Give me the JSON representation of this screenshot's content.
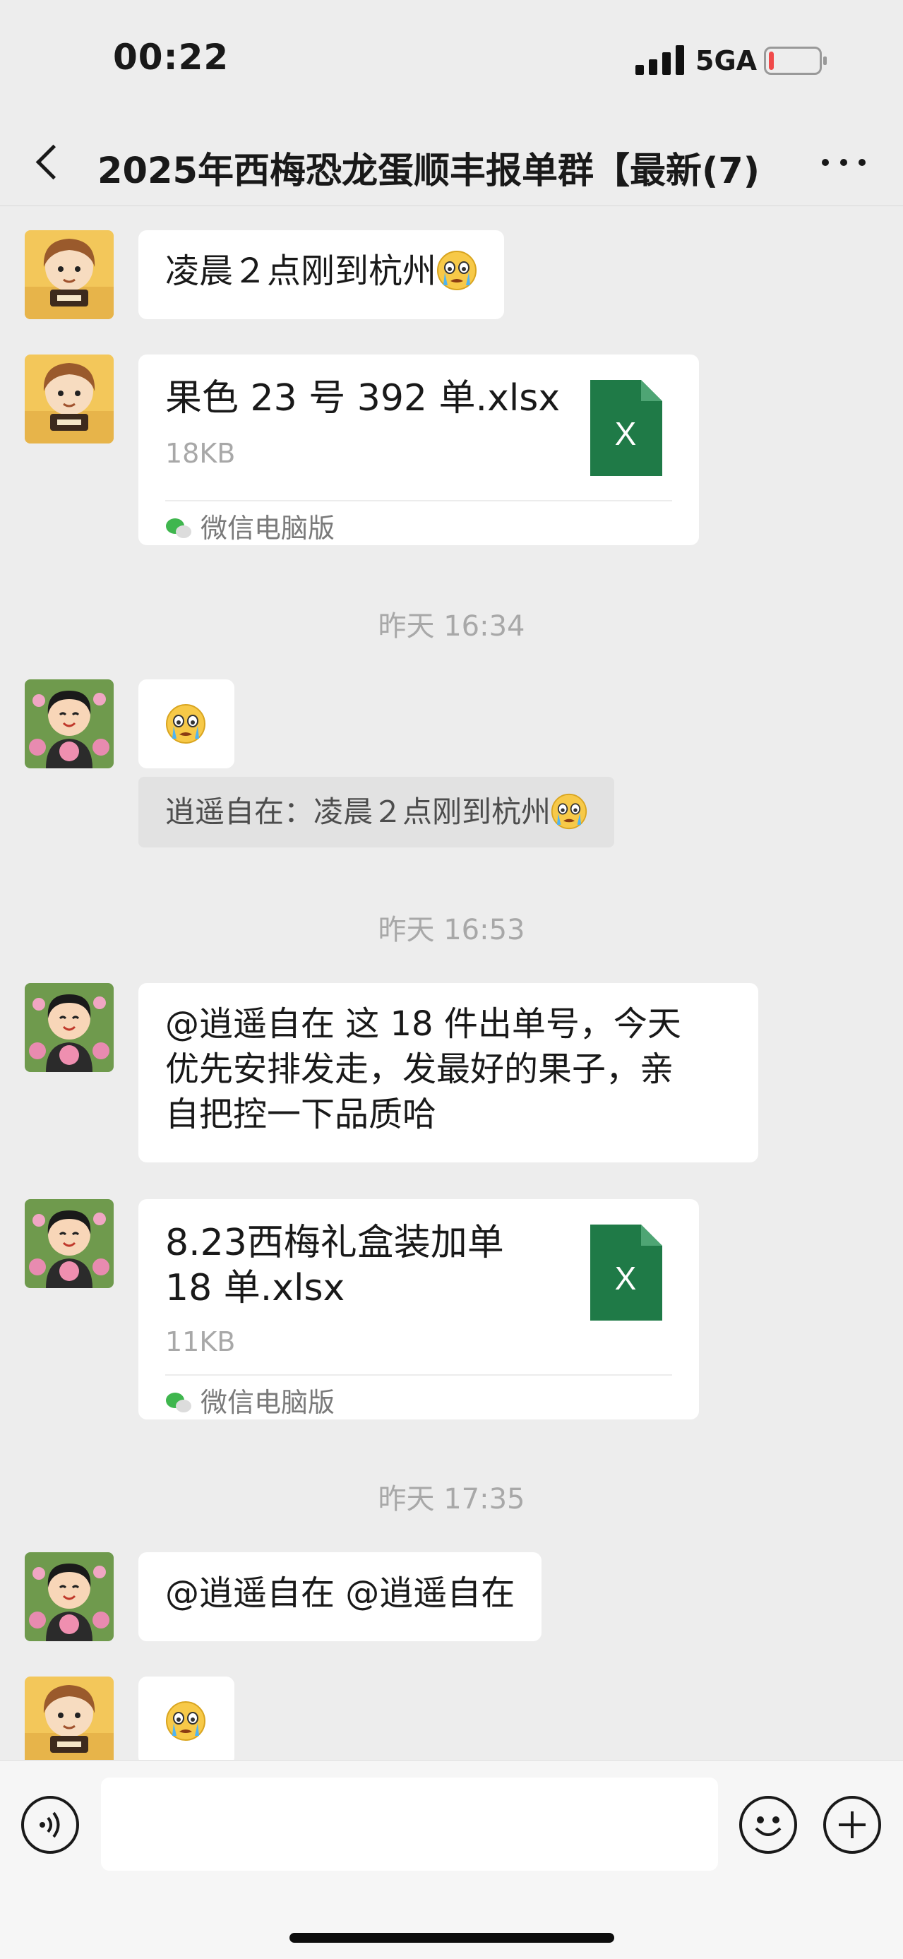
{
  "status": {
    "time": "00:22",
    "network": "5GA",
    "battery_level": 0.1
  },
  "header": {
    "title": "2025年西梅恐龙蛋顺丰报单群【最新(7)"
  },
  "messages": [
    {
      "kind": "text",
      "sender": "male-avatar",
      "text": "凌晨２点刚到杭州",
      "emoji": "crying-face"
    },
    {
      "kind": "file",
      "sender": "male-avatar",
      "file_name": "果色 23 号 392 单.xlsx",
      "file_size": "18KB",
      "source": "微信电脑版",
      "file_icon": "excel-icon"
    },
    {
      "kind": "time",
      "text": "昨天 16:34"
    },
    {
      "kind": "emoji",
      "sender": "female-avatar",
      "emoji": "crying-face"
    },
    {
      "kind": "quote",
      "text": "逍遥自在：凌晨２点刚到杭州",
      "emoji": "crying-face"
    },
    {
      "kind": "time",
      "text": "昨天 16:53"
    },
    {
      "kind": "text",
      "sender": "female-avatar",
      "lines": [
        "@逍遥自在  这 18 件出单号，今天",
        "优先安排发走，发最好的果子，亲",
        "自把控一下品质哈"
      ]
    },
    {
      "kind": "file",
      "sender": "female-avatar",
      "file_name_lines": [
        "8.23西梅礼盒装加单",
        "18 单.xlsx"
      ],
      "file_size": "11KB",
      "source": "微信电脑版",
      "file_icon": "excel-icon"
    },
    {
      "kind": "time",
      "text": "昨天 17:35"
    },
    {
      "kind": "text",
      "sender": "female-avatar",
      "text": "@逍遥自在  @逍遥自在"
    },
    {
      "kind": "emoji",
      "sender": "male-avatar",
      "emoji": "crying-face"
    }
  ],
  "icons": {
    "back": "back-arrow-icon",
    "more": "more-dots-icon",
    "voice": "voice-icon",
    "emoji": "emoji-icon",
    "plus": "plus-icon",
    "file": "excel-icon"
  },
  "colors": {
    "background": "#ededed",
    "bubble": "#ffffff",
    "excel_green": "#1f7a47",
    "timestamp": "#a8a8a8"
  }
}
